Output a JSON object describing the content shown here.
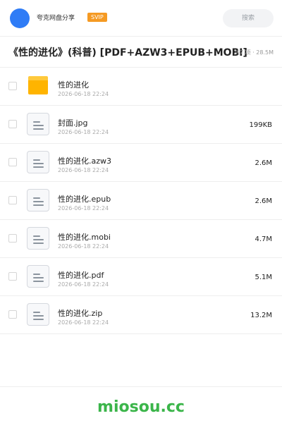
{
  "header": {
    "user_name": "夸克网盘分享",
    "badge": "SVIP",
    "search_placeholder": "搜索"
  },
  "title_row": {
    "title": "《性的进化》(科普) [PDF+AZW3+EPUB+MOBI]",
    "stats": "共7 项 · 28.5M"
  },
  "files": [
    {
      "type": "folder",
      "name": "性的进化",
      "date": "2026-06-18 22:24",
      "size": ""
    },
    {
      "type": "file",
      "name": "封面.jpg",
      "date": "2026-06-18 22:24",
      "size": "199KB"
    },
    {
      "type": "file",
      "name": "性的进化.azw3",
      "date": "2026-06-18 22:24",
      "size": "2.6M"
    },
    {
      "type": "file",
      "name": "性的进化.epub",
      "date": "2026-06-18 22:24",
      "size": "2.6M"
    },
    {
      "type": "file",
      "name": "性的进化.mobi",
      "date": "2026-06-18 22:24",
      "size": "4.7M"
    },
    {
      "type": "file",
      "name": "性的进化.pdf",
      "date": "2026-06-18 22:24",
      "size": "5.1M"
    },
    {
      "type": "file",
      "name": "性的进化.zip",
      "date": "2026-06-18 22:24",
      "size": "13.2M"
    }
  ],
  "footer": {
    "brand": "miosou.cc"
  },
  "colors": {
    "avatar": "#2f7cf6",
    "badge": "#f59a23",
    "folder": "#ffb400",
    "brand": "#3bb54a"
  }
}
